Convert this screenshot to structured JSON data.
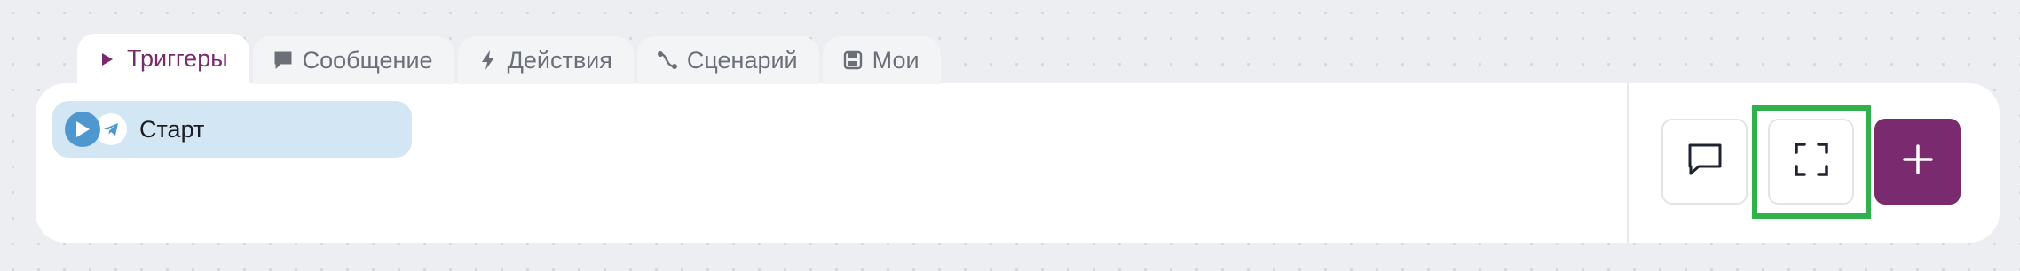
{
  "tabs": [
    {
      "label": "Триггеры",
      "icon": "play-triangle-icon",
      "active": true
    },
    {
      "label": "Сообщение",
      "icon": "chat-bubble-icon",
      "active": false
    },
    {
      "label": "Действия",
      "icon": "lightning-bolt-icon",
      "active": false
    },
    {
      "label": "Сценарий",
      "icon": "route-icon",
      "active": false
    },
    {
      "label": "Мои",
      "icon": "save-disk-icon",
      "active": false
    }
  ],
  "trigger": {
    "label": "Старт",
    "icons": [
      "play-icon",
      "telegram-icon"
    ]
  },
  "toolbar": {
    "buttons": [
      "comment-icon",
      "expand-icon",
      "plus-icon"
    ]
  },
  "colors": {
    "accent": "#7a2a6e",
    "trigger_bg": "#d2e6f3",
    "trigger_icon": "#4f97cf",
    "highlight": "#2fb24c"
  }
}
